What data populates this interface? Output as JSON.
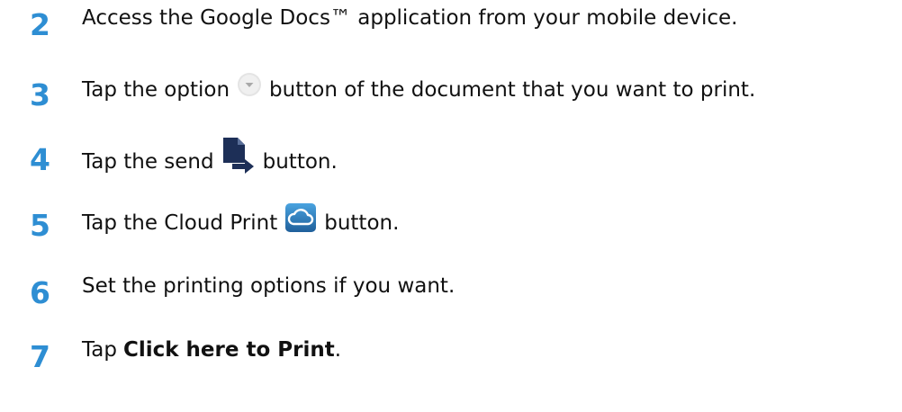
{
  "steps": [
    {
      "number": "2",
      "text": "Access the Google Docs™ application from your mobile device."
    },
    {
      "number": "3",
      "text_before": "Tap the option",
      "icon": "option-circle-icon",
      "text_after": "button of the document that you want to print."
    },
    {
      "number": "4",
      "text_before": "Tap the send",
      "icon": "send-document-icon",
      "text_after": "button."
    },
    {
      "number": "5",
      "text_before": "Tap the Cloud Print",
      "icon": "cloud-print-icon",
      "text_after": "button."
    },
    {
      "number": "6",
      "text": "Set the printing options if you want."
    },
    {
      "number": "7",
      "text_before": "Tap",
      "bold": "Click here to Print",
      "text_after": "."
    }
  ],
  "colors": {
    "step_number": "#2e8ed3",
    "text": "#111111",
    "send_icon": "#1d2f57",
    "cloud_icon_bg": "#2a78b8",
    "option_icon": "#dddddd"
  }
}
